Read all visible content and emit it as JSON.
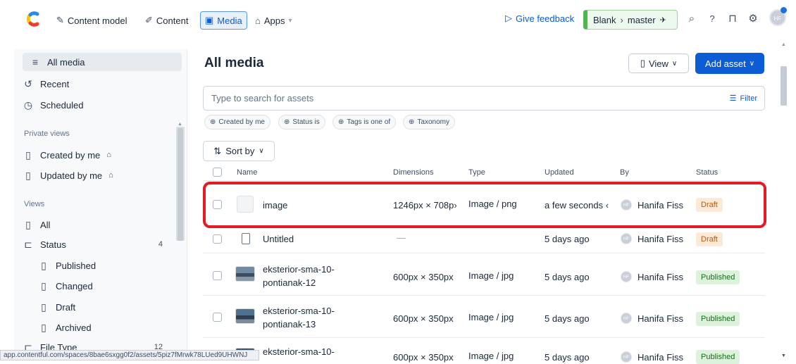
{
  "topbar": {
    "nav": [
      {
        "label": "Content model"
      },
      {
        "label": "Content"
      },
      {
        "label": "Media"
      },
      {
        "label": "Apps"
      }
    ],
    "feedback": "Give feedback",
    "env_space": "Blank",
    "env_branch": "master",
    "avatar_initials": "HF"
  },
  "sidebar": {
    "all_media": "All media",
    "recent": "Recent",
    "scheduled": "Scheduled",
    "private_views_heading": "Private views",
    "created_by_me": "Created by me",
    "updated_by_me": "Updated by me",
    "views_heading": "Views",
    "all": "All",
    "status": "Status",
    "status_count": "4",
    "published": "Published",
    "changed": "Changed",
    "draft": "Draft",
    "archived": "Archived",
    "file_type": "File Type",
    "file_type_count": "12"
  },
  "main": {
    "title": "All media",
    "view_label": "View",
    "add_asset_label": "Add asset",
    "search_placeholder": "Type to search for assets",
    "filter_label": "Filter",
    "chips": [
      "Created by me",
      "Status is",
      "Tags is one of",
      "Taxonomy"
    ],
    "sort_label": "Sort by"
  },
  "table": {
    "headers": {
      "name": "Name",
      "dimensions": "Dimensions",
      "type": "Type",
      "updated": "Updated",
      "by": "By",
      "status": "Status"
    },
    "rows": [
      {
        "name1": "image",
        "name2": "",
        "dimensions": "1246px × 708p›",
        "type": "Image / png",
        "updated": "a few seconds ‹",
        "by": "Hanifa Fiss",
        "status": "Draft"
      },
      {
        "name1": "Untitled",
        "name2": "",
        "dimensions": "—",
        "type": "",
        "updated": "5 days ago",
        "by": "Hanifa Fiss",
        "status": "Draft"
      },
      {
        "name1": "eksterior-sma-10-",
        "name2": "pontianak-12",
        "dimensions": "600px × 350px",
        "type": "Image / jpg",
        "updated": "5 days ago",
        "by": "Hanifa Fiss",
        "status": "Published"
      },
      {
        "name1": "eksterior-sma-10-",
        "name2": "pontianak-13",
        "dimensions": "600px × 350px",
        "type": "Image / jpg",
        "updated": "5 days ago",
        "by": "Hanifa Fiss",
        "status": "Published"
      },
      {
        "name1": "eksterior-sma-10-",
        "name2": "",
        "dimensions": "600px × 350px",
        "type": "Image / jpg",
        "updated": "5 days ago",
        "by": "Hanifa Fiss",
        "status": "Published"
      }
    ]
  },
  "statusbar_url": "app.contentful.com/spaces/8bae6sxgg0f2/assets/5piz7fMrwk78LUed9UHWNJ",
  "colors": {
    "accent": "#0b5cd5",
    "highlight": "#e31b23",
    "draft_bg": "#fde9d5",
    "published_bg": "#dcf2db"
  }
}
